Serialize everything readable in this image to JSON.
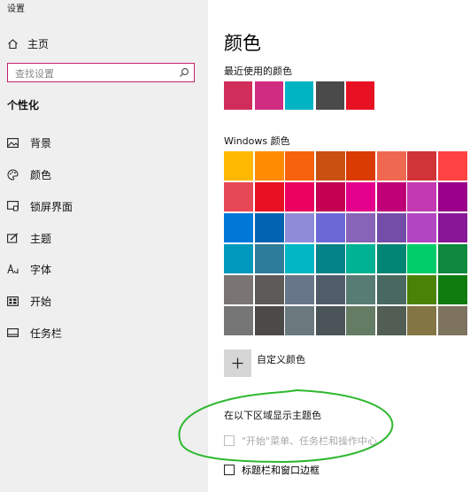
{
  "window": {
    "title": "设置"
  },
  "sidebar": {
    "home_label": "主页",
    "search_placeholder": "查找设置",
    "section_title": "个性化",
    "items": [
      {
        "label": "背景",
        "icon": "picture-icon"
      },
      {
        "label": "颜色",
        "icon": "palette-icon"
      },
      {
        "label": "锁屏界面",
        "icon": "lock-screen-icon"
      },
      {
        "label": "主题",
        "icon": "theme-icon"
      },
      {
        "label": "字体",
        "icon": "font-icon"
      },
      {
        "label": "开始",
        "icon": "start-icon"
      },
      {
        "label": "任务栏",
        "icon": "taskbar-icon"
      }
    ]
  },
  "main": {
    "title": "颜色",
    "recent_heading": "最近使用的颜色",
    "recent_colors": [
      "#d12d5a",
      "#cf2c82",
      "#01b4c4",
      "#4a4a4a",
      "#e81123"
    ],
    "windows_heading": "Windows 颜色",
    "windows_colors": [
      [
        "#ffb900",
        "#ff8c00",
        "#f7630c",
        "#ca5010",
        "#da3b01",
        "#ef6950",
        "#d13438",
        "#ff4343"
      ],
      [
        "#e74856",
        "#e81123",
        "#ea005e",
        "#c30052",
        "#e3008c",
        "#bf0077",
        "#c239b3",
        "#9a0089"
      ],
      [
        "#0078d7",
        "#0063b1",
        "#8e8cd8",
        "#6b69d6",
        "#8764b8",
        "#744da9",
        "#b146c2",
        "#881798"
      ],
      [
        "#0099bc",
        "#2d7d9a",
        "#00b7c3",
        "#038387",
        "#00b294",
        "#018574",
        "#00cc6a",
        "#10893e"
      ],
      [
        "#7a7574",
        "#5d5a58",
        "#68768a",
        "#515c6b",
        "#567c73",
        "#486860",
        "#498205",
        "#107c10"
      ],
      [
        "#767676",
        "#4c4a48",
        "#69797e",
        "#4a5459",
        "#647c64",
        "#525e54",
        "#847545",
        "#7e735f"
      ]
    ],
    "custom_color_label": "自定义颜色",
    "show_accent_heading": "在以下区域显示主题色",
    "option_start_taskbar": "\"开始\"菜单、任务栏和操作中心",
    "option_title_bars": "标题栏和窗口边框"
  },
  "colors": {
    "search_border": "#c3206d",
    "annotation": "#2fb82f",
    "sidebar_bg": "#efefef"
  }
}
